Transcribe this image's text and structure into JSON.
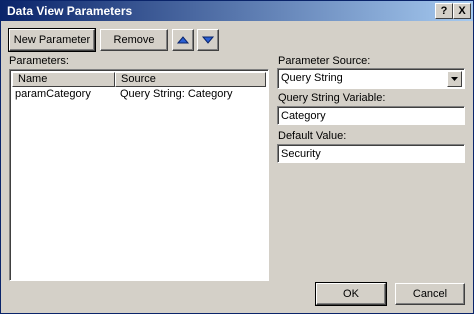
{
  "dialog": {
    "title": "Data View Parameters",
    "help_label": "?",
    "close_label": "X"
  },
  "toolbar": {
    "new_parameter_label": "New Parameter",
    "remove_label": "Remove",
    "move_up_icon": "arrow-up-icon",
    "move_down_icon": "arrow-down-icon"
  },
  "parameters": {
    "label": "Parameters:",
    "columns": [
      "Name",
      "Source"
    ],
    "rows": [
      {
        "name": "paramCategory",
        "source": "Query String: Category"
      }
    ]
  },
  "details": {
    "source_label": "Parameter Source:",
    "source_value": "Query String",
    "variable_label": "Query String Variable:",
    "variable_value": "Category",
    "default_label": "Default Value:",
    "default_value": "Security"
  },
  "footer": {
    "ok_label": "OK",
    "cancel_label": "Cancel"
  },
  "colors": {
    "titlebar_start": "#0a246a",
    "titlebar_end": "#a6caf0",
    "face": "#d4d0c8"
  }
}
